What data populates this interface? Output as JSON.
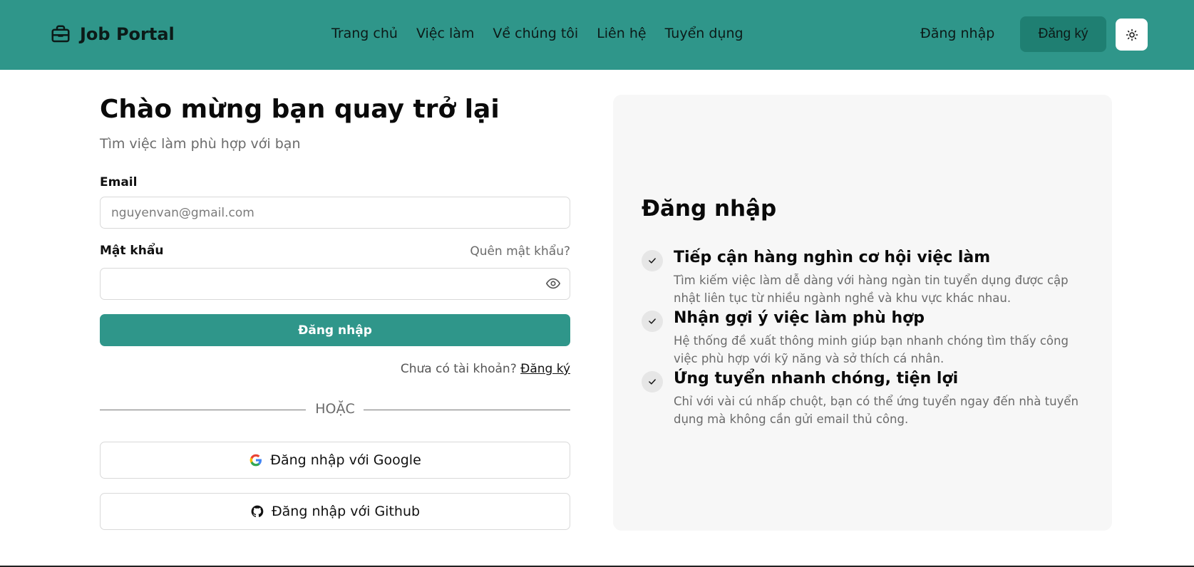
{
  "header": {
    "brand": "Job Portal",
    "nav": [
      "Trang chủ",
      "Việc làm",
      "Về chúng tôi",
      "Liên hệ",
      "Tuyển dụng"
    ],
    "login_label": "Đăng nhập",
    "register_label": "Đăng ký",
    "theme_icon": "sun-icon",
    "colors": {
      "header_bg": "#2f968a",
      "register_bg": "#1f7f72"
    }
  },
  "form": {
    "title": "Chào mừng bạn quay trở lại",
    "subtitle": "Tìm việc làm phù hợp với bạn",
    "email_label": "Email",
    "email_placeholder": "nguyenvan@gmail.com",
    "password_label": "Mật khẩu",
    "forgot_label": "Quên mật khẩu?",
    "submit_label": "Đăng nhập",
    "no_account_text": "Chưa có tài khoản?",
    "register_link": "Đăng ký",
    "or_text": "HOẶC",
    "google_label": "Đăng nhập với Google",
    "github_label": "Đăng nhập với Github"
  },
  "panel": {
    "title": "Đăng nhập",
    "features": [
      {
        "title": "Tiếp cận hàng nghìn cơ hội việc làm",
        "desc": "Tìm kiếm việc làm dễ dàng với hàng ngàn tin tuyển dụng được cập nhật liên tục từ nhiều ngành nghề và khu vực khác nhau."
      },
      {
        "title": "Nhận gợi ý việc làm phù hợp",
        "desc": "Hệ thống đề xuất thông minh giúp bạn nhanh chóng tìm thấy công việc phù hợp với kỹ năng và sở thích cá nhân."
      },
      {
        "title": "Ứng tuyển nhanh chóng, tiện lợi",
        "desc": "Chỉ với vài cú nhấp chuột, bạn có thể ứng tuyển ngay đến nhà tuyển dụng mà không cần gửi email thủ công."
      }
    ]
  }
}
